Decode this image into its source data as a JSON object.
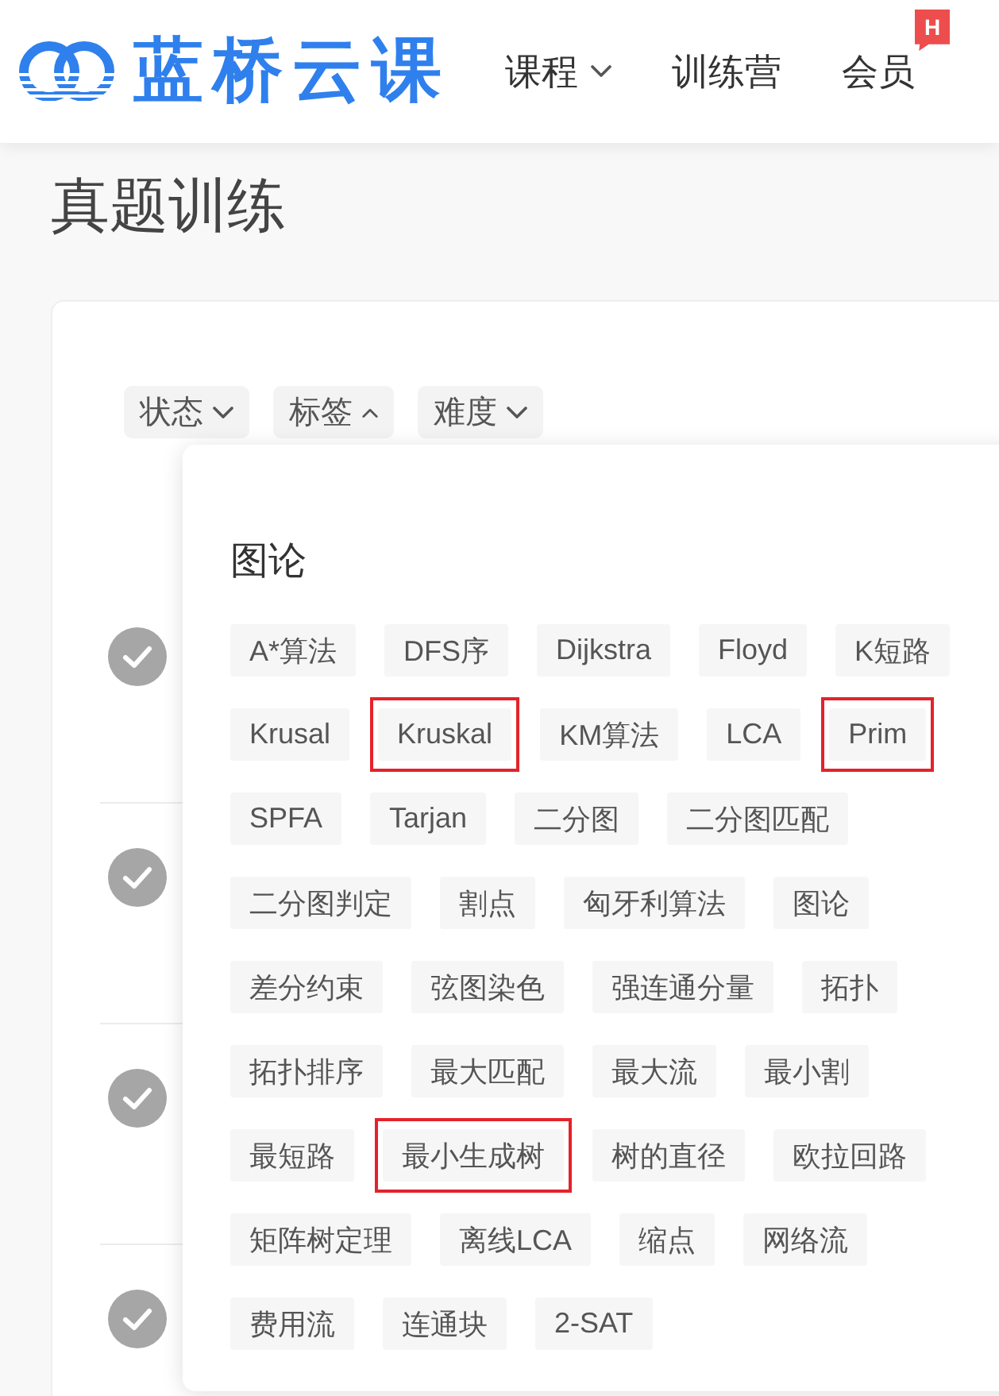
{
  "header": {
    "logo_text": "蓝桥云课",
    "nav": [
      {
        "label": "课程",
        "dropdown": true
      },
      {
        "label": "训练营",
        "dropdown": false
      },
      {
        "label": "会员",
        "dropdown": false,
        "badge": "H"
      }
    ]
  },
  "page_title": "真题训练",
  "filters": [
    {
      "label": "状态",
      "expanded": false
    },
    {
      "label": "标签",
      "expanded": true
    },
    {
      "label": "难度",
      "expanded": false
    }
  ],
  "tag_menu": {
    "heading": "图论",
    "tags": [
      {
        "label": "A*算法",
        "highlighted": false
      },
      {
        "label": "DFS序",
        "highlighted": false
      },
      {
        "label": "Dijkstra",
        "highlighted": false
      },
      {
        "label": "Floyd",
        "highlighted": false
      },
      {
        "label": "K短路",
        "highlighted": false
      },
      {
        "label": "Krusal",
        "highlighted": false
      },
      {
        "label": "Kruskal",
        "highlighted": true
      },
      {
        "label": "KM算法",
        "highlighted": false
      },
      {
        "label": "LCA",
        "highlighted": false
      },
      {
        "label": "Prim",
        "highlighted": true
      },
      {
        "label": "SPFA",
        "highlighted": false
      },
      {
        "label": "Tarjan",
        "highlighted": false
      },
      {
        "label": "二分图",
        "highlighted": false
      },
      {
        "label": "二分图匹配",
        "highlighted": false
      },
      {
        "label": "二分图判定",
        "highlighted": false
      },
      {
        "label": "割点",
        "highlighted": false
      },
      {
        "label": "匈牙利算法",
        "highlighted": false
      },
      {
        "label": "图论",
        "highlighted": false
      },
      {
        "label": "差分约束",
        "highlighted": false
      },
      {
        "label": "弦图染色",
        "highlighted": false
      },
      {
        "label": "强连通分量",
        "highlighted": false
      },
      {
        "label": "拓扑",
        "highlighted": false
      },
      {
        "label": "拓扑排序",
        "highlighted": false
      },
      {
        "label": "最大匹配",
        "highlighted": false
      },
      {
        "label": "最大流",
        "highlighted": false
      },
      {
        "label": "最小割",
        "highlighted": false
      },
      {
        "label": "最短路",
        "highlighted": false
      },
      {
        "label": "最小生成树",
        "highlighted": true
      },
      {
        "label": "树的直径",
        "highlighted": false
      },
      {
        "label": "欧拉回路",
        "highlighted": false
      },
      {
        "label": "矩阵树定理",
        "highlighted": false
      },
      {
        "label": "离线LCA",
        "highlighted": false
      },
      {
        "label": "缩点",
        "highlighted": false
      },
      {
        "label": "网络流",
        "highlighted": false
      },
      {
        "label": "费用流",
        "highlighted": false
      },
      {
        "label": "连通块",
        "highlighted": false
      },
      {
        "label": "2-SAT",
        "highlighted": false
      }
    ]
  },
  "problem_rows": [
    {
      "checked": true
    },
    {
      "checked": true
    },
    {
      "checked": true
    },
    {
      "checked": true
    }
  ]
}
